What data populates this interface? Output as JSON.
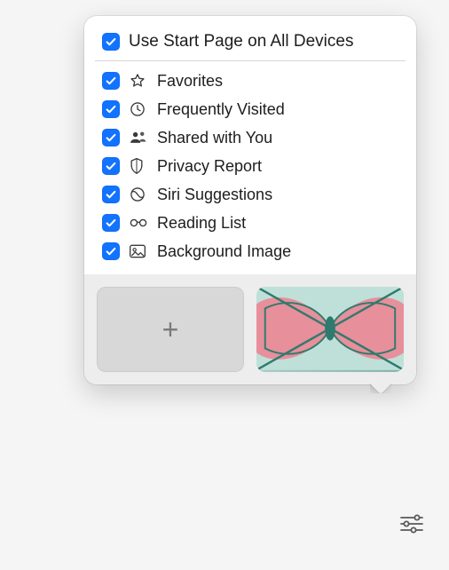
{
  "colors": {
    "accent": "#1173ff"
  },
  "header": {
    "label": "Use Start Page on All Devices",
    "checked": true
  },
  "items": [
    {
      "icon": "star-icon",
      "label": "Favorites",
      "checked": true
    },
    {
      "icon": "clock-icon",
      "label": "Frequently Visited",
      "checked": true
    },
    {
      "icon": "shared-icon",
      "label": "Shared with You",
      "checked": true
    },
    {
      "icon": "shield-icon",
      "label": "Privacy Report",
      "checked": true
    },
    {
      "icon": "siri-icon",
      "label": "Siri Suggestions",
      "checked": true
    },
    {
      "icon": "glasses-icon",
      "label": "Reading List",
      "checked": true
    },
    {
      "icon": "image-icon",
      "label": "Background Image",
      "checked": true
    }
  ],
  "background_tiles": {
    "add_label": "+"
  }
}
